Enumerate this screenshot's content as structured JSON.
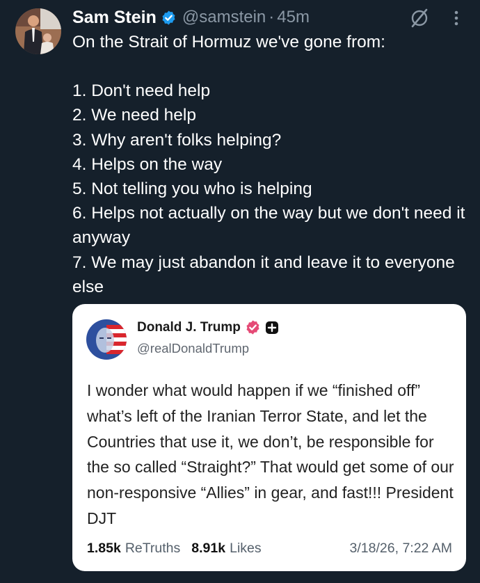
{
  "author": {
    "display_name": "Sam Stein",
    "handle": "@samstein",
    "separator": "·",
    "time": "45m"
  },
  "icons": {
    "verified": "verified-badge-icon",
    "grok": "grok-icon",
    "more": "more-icon"
  },
  "colors": {
    "background": "#15202b",
    "verified_blue": "#1d9bf0",
    "secondary_text": "#8b98a5",
    "truth_badge": "#e54a76"
  },
  "tweet": {
    "lead": "On the Strait of Hormuz we've gone from:",
    "items": [
      "1. Don't need help",
      "2. We need help",
      "3. Why aren't folks helping?",
      "4. Helps on the way",
      "5. Not telling you who is helping",
      "6. Helps not actually on the way but we don't need it anyway",
      "7. We may just abandon it and leave it to everyone else"
    ]
  },
  "quote": {
    "display_name": "Donald J. Trump",
    "handle": "@realDonaldTrump",
    "text": "I wonder what would happen if we “finished off” what’s left of the Iranian Terror State, and let the Countries that use it, we don’t, be responsible for the so called “Straight?” That would get some of our non-responsive “Allies” in gear, and fast!!! President DJT",
    "retruths_count": "1.85k",
    "retruths_label": "ReTruths",
    "likes_count": "8.91k",
    "likes_label": "Likes",
    "timestamp": "3/18/26, 7:22 AM"
  }
}
